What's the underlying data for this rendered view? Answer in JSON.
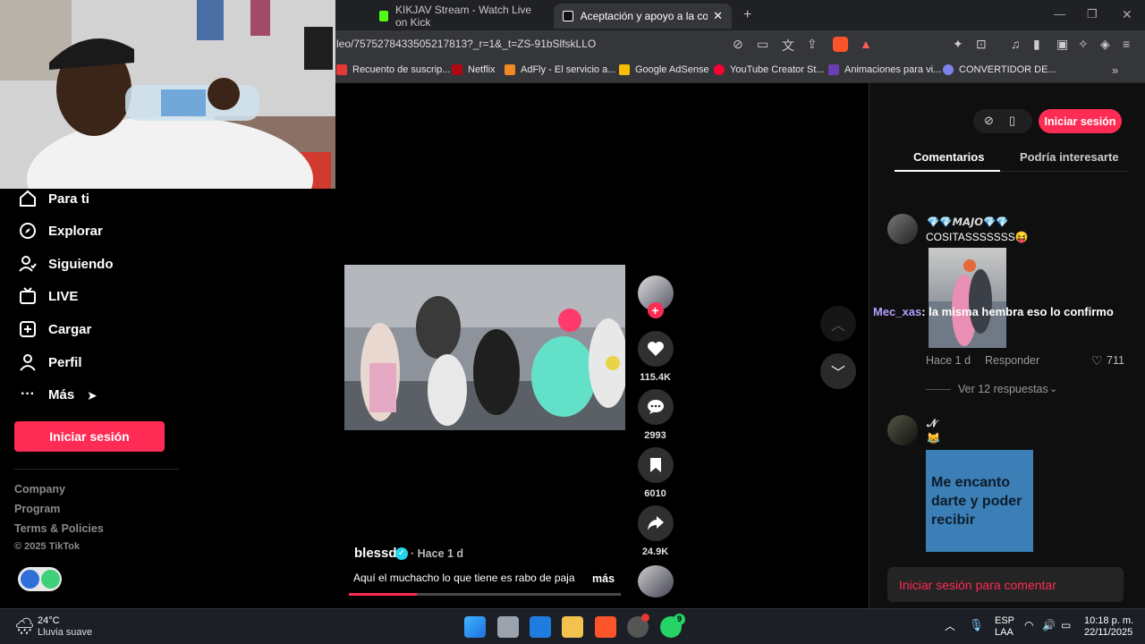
{
  "browser": {
    "tabs": [
      {
        "label": "KIKJAV Stream - Watch Live on Kick"
      },
      {
        "label": "Aceptación y apoyo a la comuni"
      }
    ],
    "url": "leo/7575278433505217813?_r=1&_t=ZS-91bSlfskLLO",
    "bookmarks": [
      {
        "label": "Recuento de suscrip..."
      },
      {
        "label": "Netflix"
      },
      {
        "label": "AdFly - El servicio a..."
      },
      {
        "label": "Google AdSense"
      },
      {
        "label": "YouTube Creator St..."
      },
      {
        "label": "Animaciones para vi..."
      },
      {
        "label": "CONVERTIDOR DE..."
      }
    ]
  },
  "sidebar": {
    "items": [
      {
        "label": "Para ti",
        "icon": "home-icon"
      },
      {
        "label": "Explorar",
        "icon": "compass-icon"
      },
      {
        "label": "Siguiendo",
        "icon": "following-icon"
      },
      {
        "label": "LIVE",
        "icon": "live-icon"
      },
      {
        "label": "Cargar",
        "icon": "upload-icon"
      },
      {
        "label": "Perfil",
        "icon": "profile-icon"
      },
      {
        "label": "Más",
        "icon": "more-icon"
      }
    ],
    "login_label": "Iniciar sesión",
    "footer": [
      "Company",
      "Program",
      "Terms & Policies"
    ],
    "copyright": "© 2025 TikTok"
  },
  "video": {
    "author": "blessd",
    "time": "· Hace 1 d",
    "caption": "Aquí el muchacho lo que tiene es rabo de paja",
    "more": "más",
    "progress": 0.25,
    "actions": {
      "likes": "115.4K",
      "comments": "2993",
      "saves": "6010",
      "shares": "24.9K"
    }
  },
  "right": {
    "login_label": "Iniciar sesión",
    "tabs": [
      "Comentarios",
      "Podría interesarte"
    ],
    "comments": [
      {
        "user": "💎💎𝙈𝘼𝙅𝙊💎💎",
        "text": "COSITASSSSSSS😝",
        "time": "Hace 1 d",
        "reply": "Responder",
        "likes": "711",
        "replies": "Ver 12 respuestas"
      },
      {
        "user": "𝓝",
        "text": "😹",
        "card_text": "Me encanto darte y poder recibir"
      }
    ],
    "overlay_user": "Mec_xas",
    "overlay_text": ": la misma hembra eso lo confirmo",
    "comment_placeholder": "Iniciar sesión para comentar"
  },
  "taskbar": {
    "temp": "24°C",
    "weather": "Lluvia suave",
    "lang": "ESP",
    "lang2": "LAA",
    "time": "10:18 p. m.",
    "date": "22/11/2025",
    "badge": "9"
  },
  "colors": {
    "accent": "#fe2c55",
    "cyan": "#25f4ee"
  }
}
